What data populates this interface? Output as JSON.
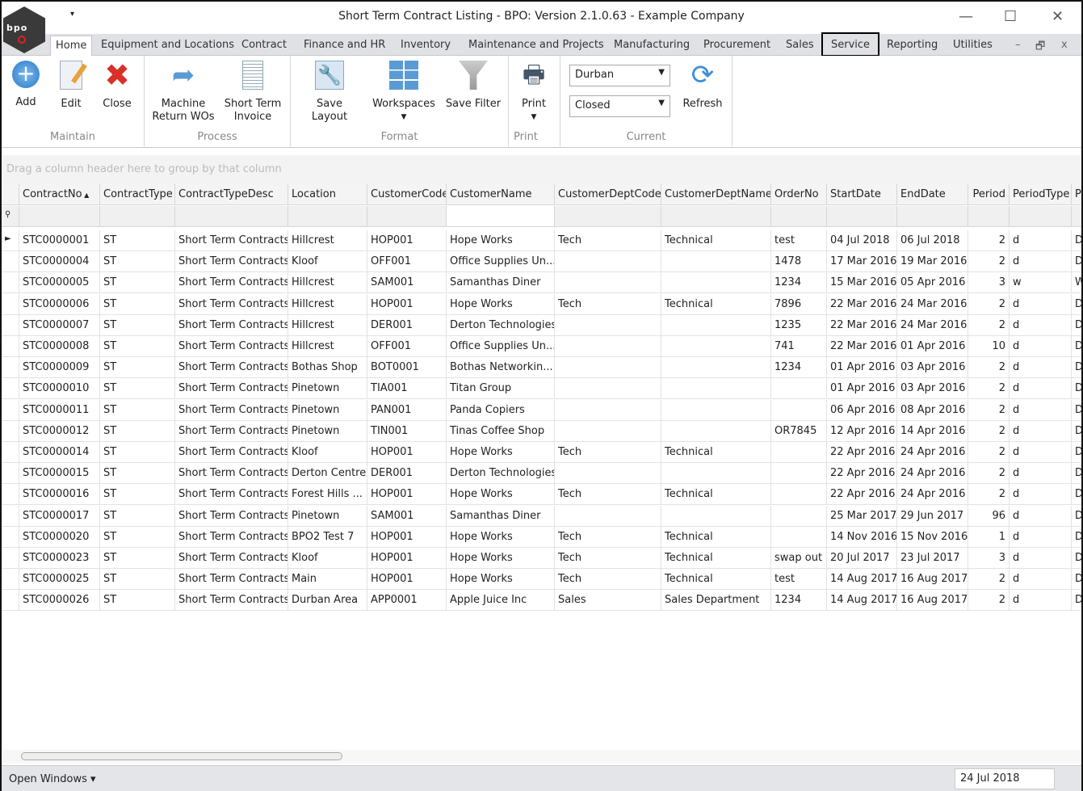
{
  "window": {
    "title": "Short Term Contract Listing - BPO: Version 2.1.0.63 - Example Company",
    "logo_text": "bpo",
    "quick_access": "▾",
    "minimize": "—",
    "maximize": "☐",
    "close": "✕"
  },
  "tabs": [
    "Home",
    "Equipment and Locations",
    "Contract",
    "Finance and HR",
    "Inventory",
    "Maintenance and Projects",
    "Manufacturing",
    "Procurement",
    "Sales",
    "Service",
    "Reporting",
    "Utilities"
  ],
  "active_tab": "Home",
  "highlighted_tab": "Service",
  "mdi": {
    "minimize": "–",
    "restore": "🗗",
    "close": "x"
  },
  "ribbon": {
    "maintain": {
      "label": "Maintain",
      "add": "Add",
      "edit": "Edit",
      "close": "Close"
    },
    "process": {
      "label": "Process",
      "machine_return": "Machine Return WOs",
      "short_term_invoice": "Short Term Invoice"
    },
    "format": {
      "label": "Format",
      "save_layout": "Save Layout",
      "workspaces": "Workspaces",
      "save_filter": "Save Filter"
    },
    "print": {
      "label": "Print",
      "print": "Print"
    },
    "current": {
      "label": "Current",
      "location": "Durban",
      "status": "Closed",
      "refresh": "Refresh"
    }
  },
  "grid": {
    "group_hint": "Drag a column header here to group by that column",
    "sort_column": "ContractNo",
    "sort_dir": "ascending",
    "columns": [
      "ContractNo",
      "ContractType",
      "ContractTypeDesc",
      "Location",
      "CustomerCode",
      "CustomerName",
      "CustomerDeptCode",
      "CustomerDeptName",
      "OrderNo",
      "StartDate",
      "EndDate",
      "Period",
      "PeriodType",
      "P"
    ],
    "rows": [
      [
        "STC0000001",
        "ST",
        "Short Term Contracts",
        "Hillcrest",
        "HOP001",
        "Hope Works",
        "Tech",
        "Technical",
        "test",
        "04 Jul 2018",
        "06 Jul 2018",
        "2",
        "d",
        "D"
      ],
      [
        "STC0000004",
        "ST",
        "Short Term Contracts",
        "Kloof",
        "OFF001",
        "Office Supplies Un...",
        "",
        "",
        "1478",
        "17 Mar 2016",
        "19 Mar 2016",
        "2",
        "d",
        "D"
      ],
      [
        "STC0000005",
        "ST",
        "Short Term Contracts",
        "Hillcrest",
        "SAM001",
        "Samanthas Diner",
        "",
        "",
        "1234",
        "15 Mar 2016",
        "05 Apr 2016",
        "3",
        "w",
        "W"
      ],
      [
        "STC0000006",
        "ST",
        "Short Term Contracts",
        "Hillcrest",
        "HOP001",
        "Hope Works",
        "Tech",
        "Technical",
        "7896",
        "22 Mar 2016",
        "24 Mar 2016",
        "2",
        "d",
        "D"
      ],
      [
        "STC0000007",
        "ST",
        "Short Term Contracts",
        "Hillcrest",
        "DER001",
        "Derton Technologies",
        "",
        "",
        "1235",
        "22 Mar 2016",
        "24 Mar 2016",
        "2",
        "d",
        "D"
      ],
      [
        "STC0000008",
        "ST",
        "Short Term Contracts",
        "Hillcrest",
        "OFF001",
        "Office Supplies Un...",
        "",
        "",
        "741",
        "22 Mar 2016",
        "01 Apr 2016",
        "10",
        "d",
        "D"
      ],
      [
        "STC0000009",
        "ST",
        "Short Term Contracts",
        "Bothas Shop",
        "BOT0001",
        "Bothas Networkin...",
        "",
        "",
        "1234",
        "01 Apr 2016",
        "03 Apr 2016",
        "2",
        "d",
        "D"
      ],
      [
        "STC0000010",
        "ST",
        "Short Term Contracts",
        "Pinetown",
        "TIA001",
        "Titan Group",
        "",
        "",
        "",
        "01 Apr 2016",
        "03 Apr 2016",
        "2",
        "d",
        "D"
      ],
      [
        "STC0000011",
        "ST",
        "Short Term Contracts",
        "Pinetown",
        "PAN001",
        "Panda Copiers",
        "",
        "",
        "",
        "06 Apr 2016",
        "08 Apr 2016",
        "2",
        "d",
        "D"
      ],
      [
        "STC0000012",
        "ST",
        "Short Term Contracts",
        "Pinetown",
        "TIN001",
        "Tinas Coffee Shop",
        "",
        "",
        "OR7845",
        "12 Apr 2016",
        "14 Apr 2016",
        "2",
        "d",
        "D"
      ],
      [
        "STC0000014",
        "ST",
        "Short Term Contracts",
        "Kloof",
        "HOP001",
        "Hope Works",
        "Tech",
        "Technical",
        "",
        "22 Apr 2016",
        "24 Apr 2016",
        "2",
        "d",
        "D"
      ],
      [
        "STC0000015",
        "ST",
        "Short Term Contracts",
        "Derton Centre",
        "DER001",
        "Derton Technologies",
        "",
        "",
        "",
        "22 Apr 2016",
        "24 Apr 2016",
        "2",
        "d",
        "D"
      ],
      [
        "STC0000016",
        "ST",
        "Short Term Contracts",
        "Forest Hills ...",
        "HOP001",
        "Hope Works",
        "Tech",
        "Technical",
        "",
        "22 Apr 2016",
        "24 Apr 2016",
        "2",
        "d",
        "D"
      ],
      [
        "STC0000017",
        "ST",
        "Short Term Contracts",
        "Pinetown",
        "SAM001",
        "Samanthas Diner",
        "",
        "",
        "",
        "25 Mar 2017",
        "29 Jun 2017",
        "96",
        "d",
        "D"
      ],
      [
        "STC0000020",
        "ST",
        "Short Term Contracts",
        "BPO2 Test 7",
        "HOP001",
        "Hope Works",
        "Tech",
        "Technical",
        "",
        "14 Nov 2016",
        "15 Nov 2016",
        "1",
        "d",
        "D"
      ],
      [
        "STC0000023",
        "ST",
        "Short Term Contracts",
        "Kloof",
        "HOP001",
        "Hope Works",
        "Tech",
        "Technical",
        "swap out",
        "20 Jul 2017",
        "23 Jul 2017",
        "3",
        "d",
        "D"
      ],
      [
        "STC0000025",
        "ST",
        "Short Term Contracts",
        "Main",
        "HOP001",
        "Hope Works",
        "Tech",
        "Technical",
        "test",
        "14 Aug 2017",
        "16 Aug 2017",
        "2",
        "d",
        "D"
      ],
      [
        "STC0000026",
        "ST",
        "Short Term Contracts",
        "Durban Area",
        "APP0001",
        "Apple Juice Inc",
        "Sales",
        "Sales Department",
        "1234",
        "14 Aug 2017",
        "16 Aug 2017",
        "2",
        "d",
        "D"
      ]
    ]
  },
  "status": {
    "open_windows": "Open Windows ▾",
    "date": "24 Jul 2018"
  }
}
